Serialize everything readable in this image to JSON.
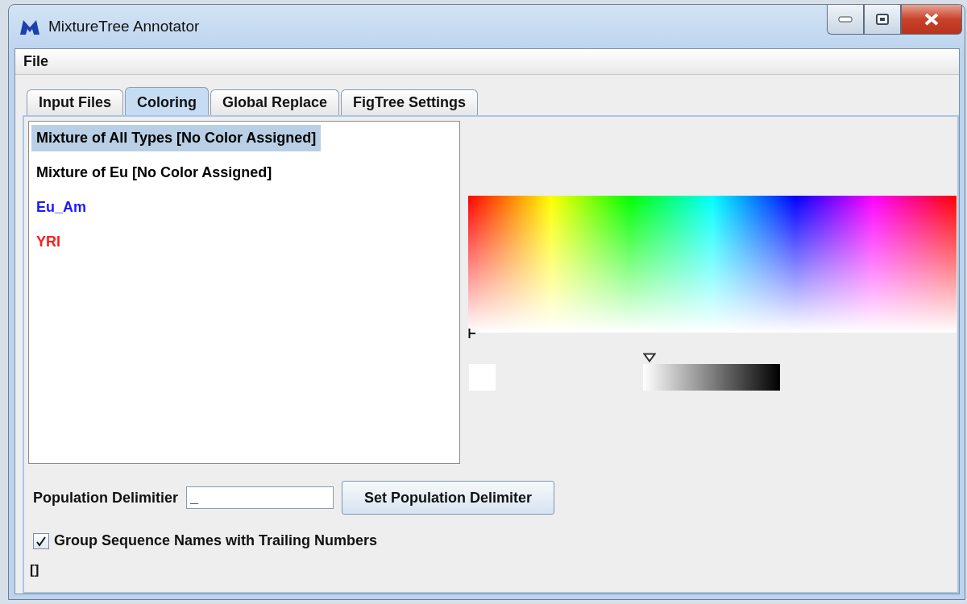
{
  "window": {
    "title": "MixtureTree Annotator"
  },
  "menu": [
    "File"
  ],
  "tabs": [
    {
      "label": "Input Files",
      "selected": false
    },
    {
      "label": "Coloring",
      "selected": true
    },
    {
      "label": "Global Replace",
      "selected": false
    },
    {
      "label": "FigTree Settings",
      "selected": false
    }
  ],
  "populations": [
    {
      "label": "Mixture of All Types [No Color Assigned]",
      "color": "#000000",
      "selected": true
    },
    {
      "label": "Mixture of Eu [No Color Assigned]",
      "color": "#000000",
      "selected": false
    },
    {
      "label": "Eu_Am",
      "color": "#1a1aff",
      "selected": false
    },
    {
      "label": "YRI",
      "color": "#ff1a1a",
      "selected": false
    }
  ],
  "delimiter": {
    "label": "Population Delimitier",
    "value": "_",
    "button": "Set Population Delimiter"
  },
  "group_option": {
    "label": "Group Sequence Names with Trailing Numbers",
    "checked": true
  },
  "status": "[]"
}
